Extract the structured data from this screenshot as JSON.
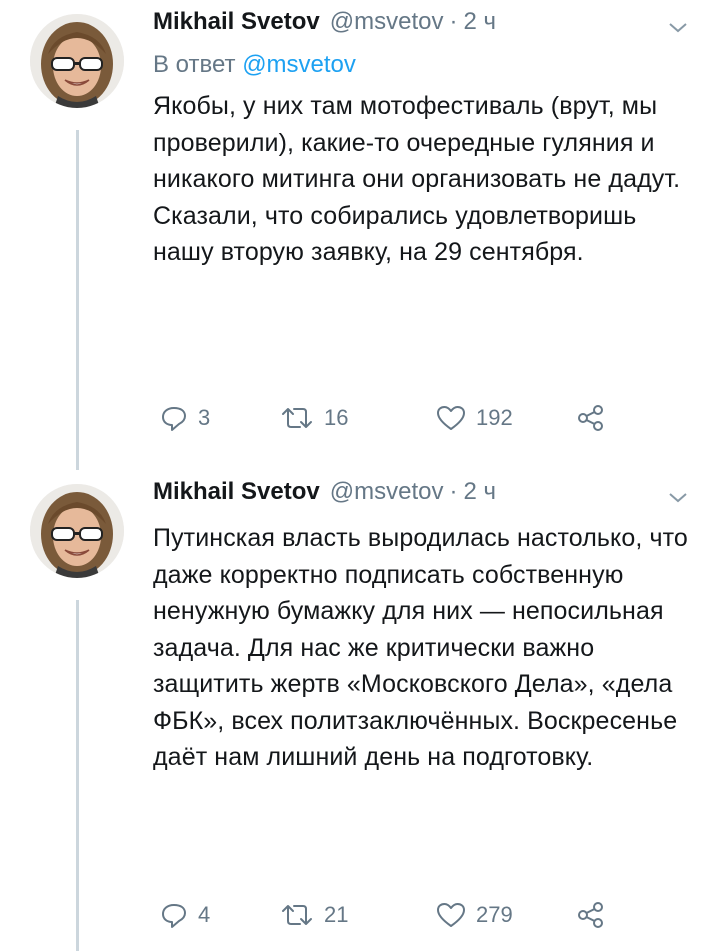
{
  "tweets": [
    {
      "name": "Mikhail Svetov",
      "handle": "@msvetov",
      "dot": "·",
      "time": "2 ч",
      "reply_prefix": "В ответ",
      "reply_mention": "@msvetov",
      "text": "Якобы, у них там мотофестиваль (врут, мы проверили), какие-то очередные гуляния и никакого митинга они организовать не дадут. Сказали, что собирались удовлетворишь нашу вторую заявку, на 29 сентября.",
      "replies": "3",
      "retweets": "16",
      "likes": "192"
    },
    {
      "name": "Mikhail Svetov",
      "handle": "@msvetov",
      "dot": "·",
      "time": "2 ч",
      "text": "Путинская власть выродилась настолько, что даже корректно подписать собственную ненужную бумажку для них — непосильная задача. Для нас же критически важно защитить жертв «Московского Дела», «дела ФБК», всех политзаключённых. Воскресенье даёт нам лишний день на подготовку.",
      "replies": "4",
      "retweets": "21",
      "likes": "279"
    }
  ],
  "icons": {
    "reply": "reply-icon",
    "retweet": "retweet-icon",
    "like": "heart-icon",
    "share": "share-icon",
    "caret": "chevron-down-icon"
  },
  "colors": {
    "name": "#14171a",
    "secondary": "#657786",
    "link": "#1da1f2",
    "thread_line": "#ccd6dd"
  }
}
